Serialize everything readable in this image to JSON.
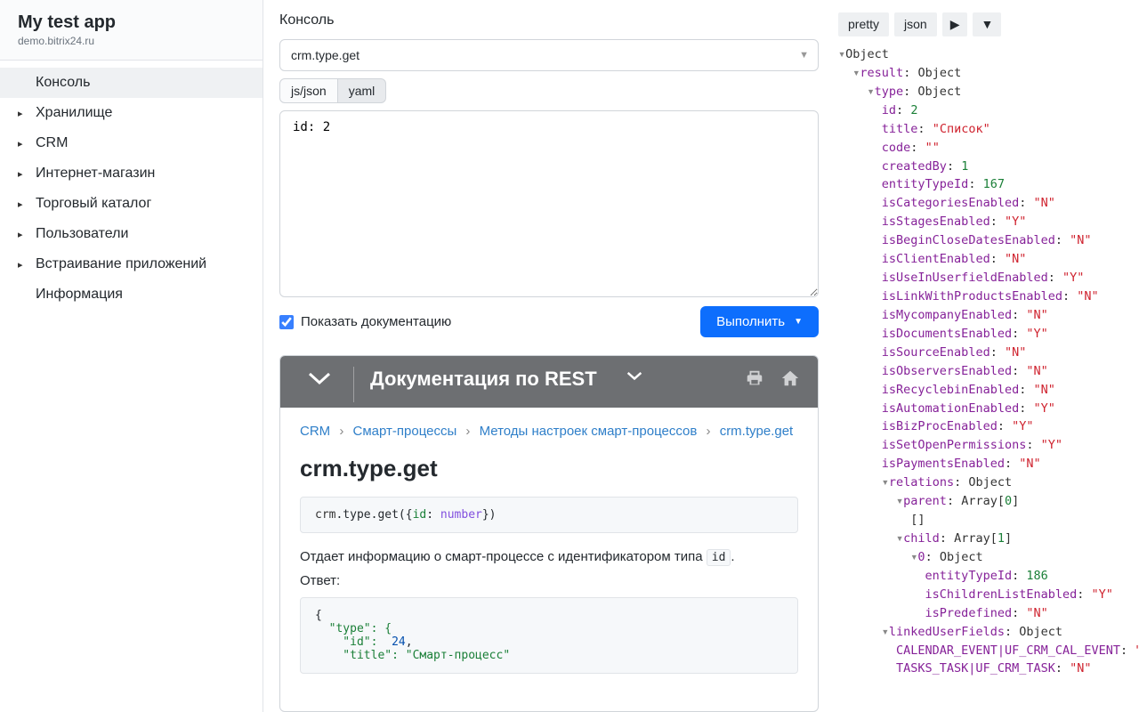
{
  "app": {
    "title": "My test app",
    "subtitle": "demo.bitrix24.ru"
  },
  "sidebar": {
    "items": [
      {
        "label": "Консоль",
        "expandable": false,
        "active": true
      },
      {
        "label": "Хранилище",
        "expandable": true
      },
      {
        "label": "CRM",
        "expandable": true
      },
      {
        "label": "Интернет-магазин",
        "expandable": true
      },
      {
        "label": "Торговый каталог",
        "expandable": true
      },
      {
        "label": "Пользователи",
        "expandable": true
      },
      {
        "label": "Встраивание приложений",
        "expandable": true
      },
      {
        "label": "Информация",
        "expandable": false
      }
    ]
  },
  "console": {
    "heading": "Консоль",
    "method": "crm.type.get",
    "fmt": {
      "js": "js/json",
      "yaml": "yaml"
    },
    "body": "id: 2",
    "show_docs_label": "Показать документацию",
    "run_label": "Выполнить"
  },
  "doc": {
    "header_title": "Документация по REST",
    "crumbs": {
      "c1": "CRM",
      "c2": "Смарт-процессы",
      "c3": "Методы настроек смарт-процессов",
      "c4": "crm.type.get"
    },
    "sep": "›",
    "title": "crm.type.get",
    "sig_pre": "crm",
    "sig_mid": ".type.get({",
    "sig_key": "id",
    "sig_colon": ": ",
    "sig_type": "number",
    "sig_end": "})",
    "desc_pre": "Отдает информацию о смарт-процессе с идентификатором типа ",
    "desc_code": "id",
    "desc_post": ".",
    "resp_label": "Ответ:",
    "resp_l1": "{",
    "resp_l2": "  \"type\": {",
    "resp_l3a": "    \"id\":  ",
    "resp_l3b": "24",
    "resp_l3c": ",",
    "resp_l4a": "    \"title\": ",
    "resp_l4b": "\"Смарт-процесс\""
  },
  "tools": {
    "pretty": "pretty",
    "json": "json",
    "play": "▶",
    "dd": "▼"
  },
  "result": {
    "obj": "Object",
    "arr": "Array",
    "id": "2",
    "title": "\"Список\"",
    "code": "\"\"",
    "createdBy": "1",
    "entityTypeId": "167",
    "isCategoriesEnabled": "\"N\"",
    "isStagesEnabled": "\"Y\"",
    "isBeginCloseDatesEnabled": "\"N\"",
    "isClientEnabled": "\"N\"",
    "isUseInUserfieldEnabled": "\"Y\"",
    "isLinkWithProductsEnabled": "\"N\"",
    "isMycompanyEnabled": "\"N\"",
    "isDocumentsEnabled": "\"Y\"",
    "isSourceEnabled": "\"N\"",
    "isObserversEnabled": "\"N\"",
    "isRecyclebinEnabled": "\"N\"",
    "isAutomationEnabled": "\"Y\"",
    "isBizProcEnabled": "\"Y\"",
    "isSetOpenPermissions": "\"Y\"",
    "isPaymentsEnabled": "\"N\"",
    "parent_len": "0",
    "parent_empty": "[]",
    "child_len": "1",
    "child_idx": "0",
    "child_entityTypeId": "186",
    "child_isChildrenListEnabled": "\"Y\"",
    "child_isPredefined": "\"N\"",
    "luf1": "CALENDAR_EVENT|UF_CRM_CAL_EVENT",
    "luf1v": "\"N\"",
    "luf2": "TASKS_TASK|UF_CRM_TASK",
    "luf2v": "\"N\""
  }
}
